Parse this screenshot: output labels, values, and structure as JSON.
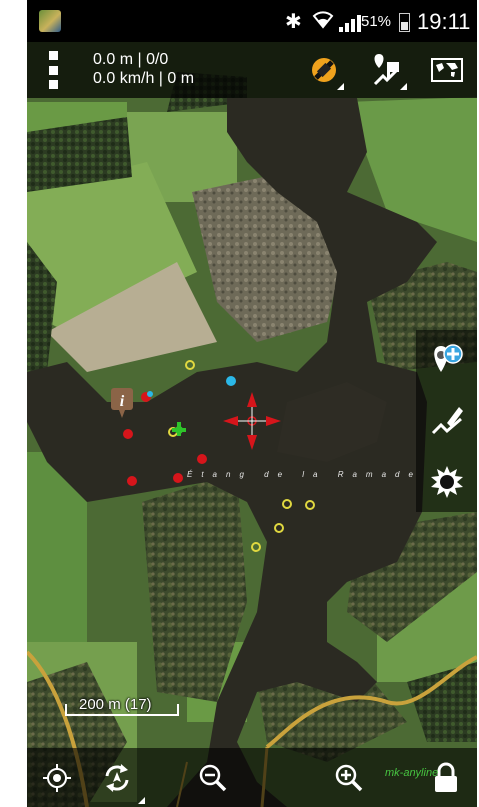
{
  "status_bar": {
    "battery_percent": "51%",
    "time": "19:11",
    "bluetooth_icon": "bluetooth-icon",
    "wifi_icon": "wifi-icon",
    "signal_icon": "cell-signal-icon"
  },
  "toolbar": {
    "menu_icon": "menu-dots-icon",
    "line1": "0.0 m | 0/0",
    "line2": "0.0 km/h | 0 m",
    "gps_icon": "gps-satellite-icon",
    "tracks_icon": "tracks-routes-icon",
    "maps_icon": "world-map-icon"
  },
  "side_buttons": [
    {
      "icon": "add-point-icon"
    },
    {
      "icon": "draw-route-icon"
    },
    {
      "icon": "brightness-settings-icon"
    }
  ],
  "map": {
    "lake_label": "Étang de la Ramade",
    "scale_label": "200 m (17)",
    "accent_red": "#d6151b",
    "accent_yellow": "#e0d840",
    "accent_cyan": "#2bb8e8",
    "accent_green": "#2ec42a",
    "road_color": "#c9a23c"
  },
  "bottom_bar": {
    "locate_icon": "my-location-icon",
    "rotate_icon": "map-rotate-icon",
    "zoom_out_icon": "zoom-out-icon",
    "zoom_in_icon": "zoom-in-icon",
    "lock_icon": "lock-icon",
    "watermark": "mk-anyline"
  }
}
